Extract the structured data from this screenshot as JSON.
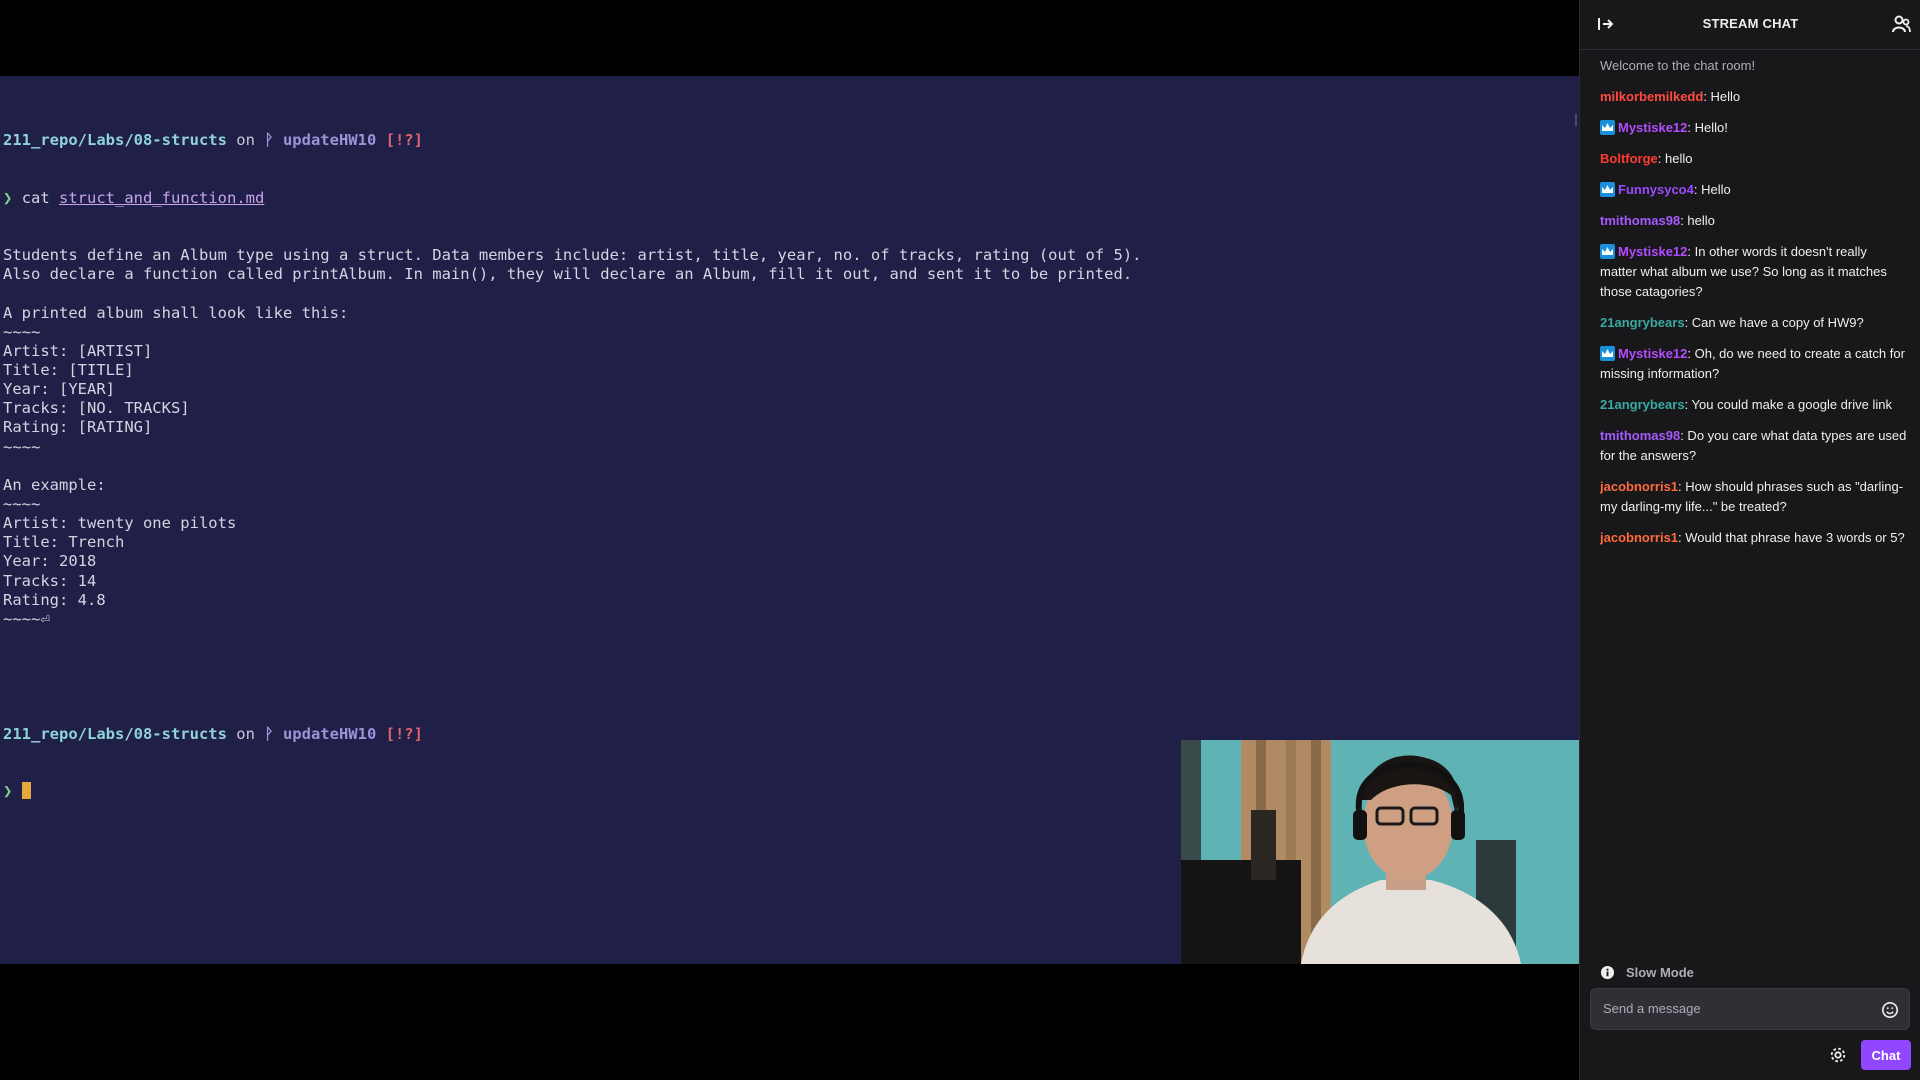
{
  "terminal": {
    "prompt1": {
      "path": "211_repo/Labs/08-structs",
      "on": " on ",
      "branch_glyph": "ᚹ",
      "branch": "updateHW10",
      "status": "[!?]"
    },
    "command": {
      "arrow": "❯",
      "cmd": "cat ",
      "file": "struct_and_function.md"
    },
    "output_lines": [
      "Students define an Album type using a struct. Data members include: artist, title, year, no. of tracks, rating (out of 5).",
      "Also declare a function called printAlbum. In main(), they will declare an Album, fill it out, and sent it to be printed.",
      "",
      "A printed album shall look like this:",
      "~~~~",
      "Artist: [ARTIST]",
      "Title: [TITLE]",
      "Year: [YEAR]",
      "Tracks: [NO. TRACKS]",
      "Rating: [RATING]",
      "~~~~",
      "",
      "An example:",
      "~~~~",
      "Artist: twenty one pilots",
      "Title: Trench",
      "Year: 2018",
      "Tracks: 14",
      "Rating: 4.8",
      "~~~~⏎"
    ],
    "prompt2": {
      "path": "211_repo/Labs/08-structs",
      "on": " on ",
      "branch_glyph": "ᚹ",
      "branch": "updateHW10",
      "status": "[!?]"
    },
    "prompt_arrow": "❯"
  },
  "chat": {
    "title": "STREAM CHAT",
    "welcome": "Welcome to the chat room!",
    "messages": [
      {
        "user": "milkorbemilkedd",
        "color": "#ff4a3d",
        "badge": false,
        "text": ": Hello"
      },
      {
        "user": "Mystiske12",
        "color": "#b54bff",
        "badge": true,
        "text": ": Hello!"
      },
      {
        "user": "Boltforge",
        "color": "#ff3b2f",
        "badge": false,
        "text": ": hello"
      },
      {
        "user": "Funnysyco4",
        "color": "#9b4bff",
        "badge": true,
        "text": ": Hello"
      },
      {
        "user": "tmithomas98",
        "color": "#a659ff",
        "badge": false,
        "text": ": hello"
      },
      {
        "user": "Mystiske12",
        "color": "#b54bff",
        "badge": true,
        "text": ": In other words it doesn't really matter what album we use? So long as it matches those catagories?"
      },
      {
        "user": "21angrybears",
        "color": "#3aa9a0",
        "badge": false,
        "text": ": Can we have a copy of HW9?"
      },
      {
        "user": "Mystiske12",
        "color": "#b54bff",
        "badge": true,
        "text": ": Oh, do we need to create a catch for missing information?"
      },
      {
        "user": "21angrybears",
        "color": "#3aa9a0",
        "badge": false,
        "text": ": You could make a google drive link"
      },
      {
        "user": "tmithomas98",
        "color": "#a659ff",
        "badge": false,
        "text": ": Do you care what data types are used for the answers?"
      },
      {
        "user": "jacobnorris1",
        "color": "#ff6a3d",
        "badge": false,
        "text": ": How should phrases such as \"darling-my darling-my life...\" be treated?"
      },
      {
        "user": "jacobnorris1",
        "color": "#ff6a3d",
        "badge": false,
        "text": ": Would that phrase have 3 words or 5?"
      }
    ],
    "slow_mode": "Slow Mode",
    "input_placeholder": "Send a message",
    "send_label": "Chat"
  }
}
